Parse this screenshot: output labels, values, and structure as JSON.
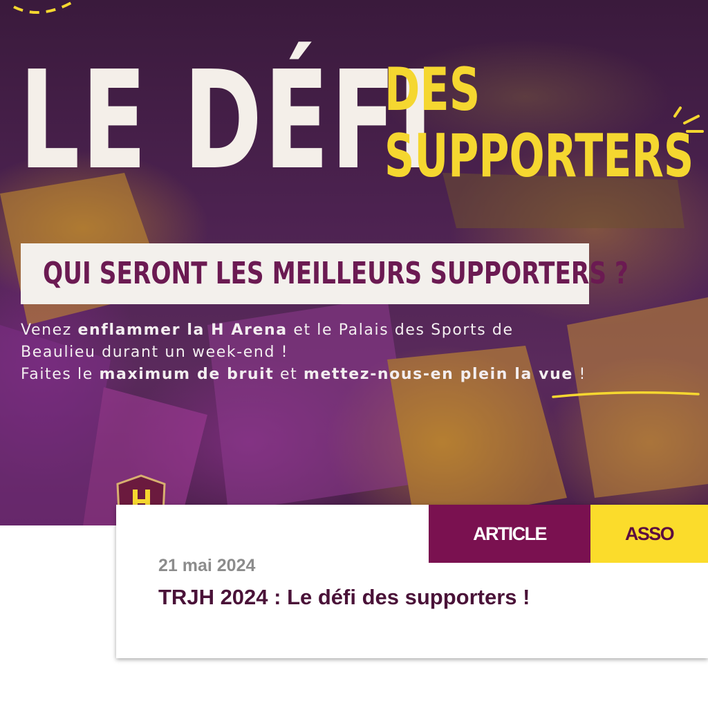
{
  "hero": {
    "title_main": "LE DÉFI",
    "title_des": "DES",
    "title_supporters": "SUPPORTERS",
    "question": "QUI SERONT LES MEILLEURS SUPPORTERS ?",
    "promo": {
      "l1_a": "Venez ",
      "l1_b": "enflammer la H Arena",
      "l1_c": " et le Palais des Sports de",
      "l2": "Beaulieu durant un week-end !",
      "l3_a": "Faites le ",
      "l3_b": "maximum de bruit",
      "l3_c": " et ",
      "l3_d": "mettez-nous-en plein la vue",
      "l3_e": " !"
    },
    "colors": {
      "purple_bg": "#4c2250",
      "yellow": "#f5d730",
      "cream": "#f4efe9",
      "plum_text": "#6b1a52"
    }
  },
  "card": {
    "tags": [
      "ARTICLE",
      "ASSO"
    ],
    "date": "21 mai 2024",
    "title": "TRJH 2024 : Le défi des supporters !",
    "colors": {
      "article_tag": "#7a1150",
      "asso_tag": "#fbdc2b",
      "title": "#4a1238",
      "date": "#8c8c8c"
    }
  }
}
